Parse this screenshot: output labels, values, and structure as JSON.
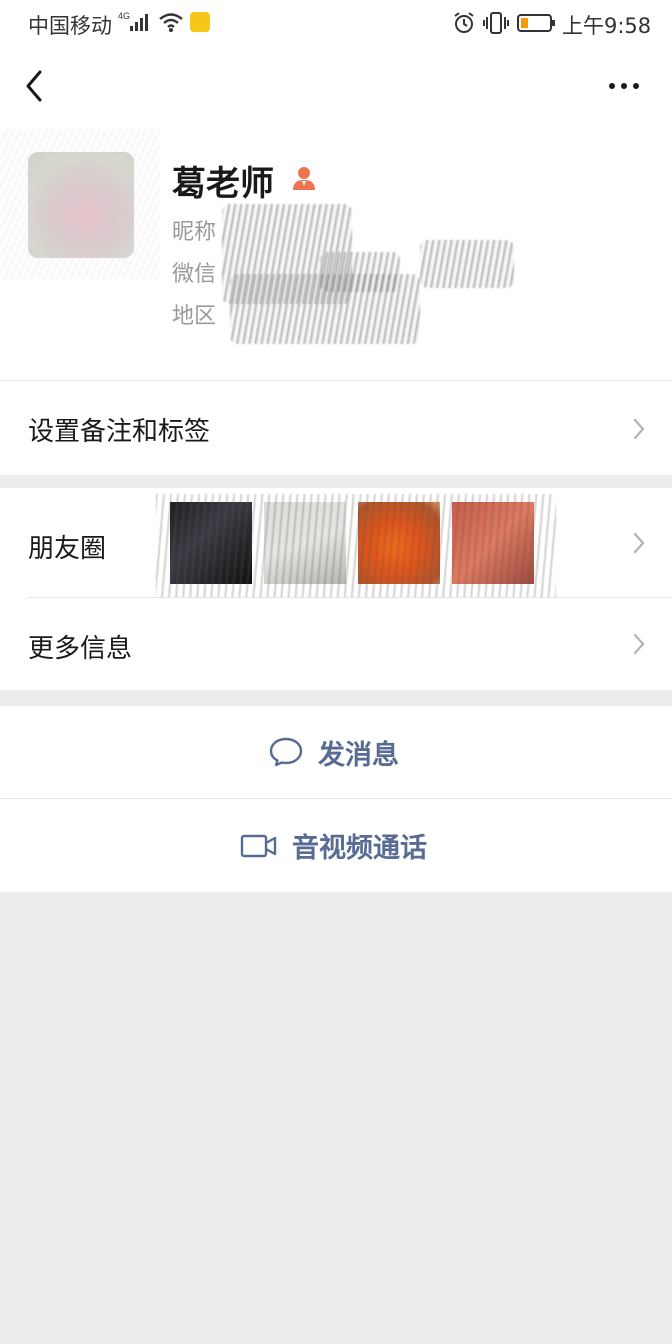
{
  "status_bar": {
    "carrier": "中国移动",
    "network": "4G",
    "time": "上午9:58",
    "battery_level": 0.2
  },
  "nav": {
    "back_icon": "chevron-left-icon",
    "more_icon": "ellipsis-icon"
  },
  "profile": {
    "name": "葛老师",
    "badge_icon": "teacher-icon",
    "nickname_label": "昵称",
    "wechat_id_label": "微信",
    "region_label": "地区"
  },
  "cells": {
    "remark": "设置备注和标签",
    "moments": "朋友圈",
    "more_info": "更多信息"
  },
  "actions": {
    "message": "发消息",
    "video_call": "音视频通话"
  },
  "colors": {
    "link_blue": "#576b95",
    "background": "#ededed",
    "teacher_icon": "#f0734f"
  }
}
